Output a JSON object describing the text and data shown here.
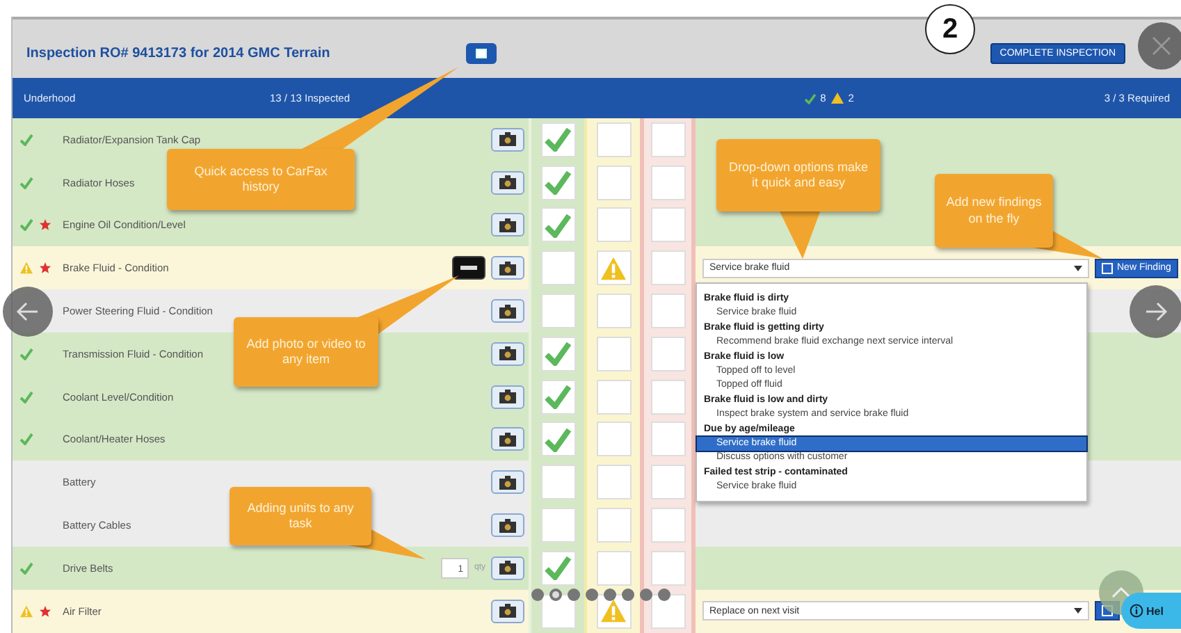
{
  "figure_number": "2",
  "header": {
    "title": "Inspection RO# 9413173 for 2014 GMC Terrain",
    "complete_button": "COMPLETE INSPECTION"
  },
  "section_bar": {
    "name": "Underhood",
    "progress": "13 / 13 Inspected",
    "ok_count": "8",
    "warning_count": "2",
    "required": "3 / 3 Required"
  },
  "rows": [
    {
      "name": "Radiator/Expansion Tank Cap",
      "ok": true,
      "warning": false,
      "failed": false,
      "required": false,
      "video": false
    },
    {
      "name": "Radiator Hoses",
      "ok": true,
      "warning": false,
      "failed": false,
      "required": false,
      "video": false
    },
    {
      "name": "Engine Oil Condition/Level",
      "ok": true,
      "warning": false,
      "failed": false,
      "required": true,
      "video": false
    },
    {
      "name": "Brake Fluid - Condition",
      "ok": false,
      "warning": true,
      "failed": false,
      "required": true,
      "video": true,
      "finding": "Service brake fluid",
      "new_finding": {
        "kind": "full",
        "label": "New Finding"
      }
    },
    {
      "name": "Power Steering Fluid - Condition",
      "ok": false,
      "warning": false,
      "failed": false,
      "required": false,
      "video": false
    },
    {
      "name": "Transmission Fluid - Condition",
      "ok": true,
      "warning": false,
      "failed": false,
      "required": false,
      "video": false
    },
    {
      "name": "Coolant Level/Condition",
      "ok": true,
      "warning": false,
      "failed": false,
      "required": false,
      "video": false
    },
    {
      "name": "Coolant/Heater Hoses",
      "ok": true,
      "warning": false,
      "failed": false,
      "required": false,
      "video": false
    },
    {
      "name": "Battery",
      "ok": false,
      "warning": false,
      "failed": false,
      "required": false,
      "video": false
    },
    {
      "name": "Battery Cables",
      "ok": false,
      "warning": false,
      "failed": false,
      "required": false,
      "video": false
    },
    {
      "name": "Drive Belts",
      "ok": true,
      "warning": false,
      "failed": false,
      "required": false,
      "video": false,
      "units": {
        "value": "1",
        "unit": "qty"
      }
    },
    {
      "name": "Air Filter",
      "ok": false,
      "warning": true,
      "failed": false,
      "required": true,
      "video": false,
      "finding": "Replace on next visit",
      "new_finding": {
        "kind": "icon"
      }
    }
  ],
  "dropdown_options": [
    {
      "label": "Brake fluid is dirty",
      "kind": "group",
      "selected": false
    },
    {
      "label": "Service brake fluid",
      "kind": "option",
      "selected": false
    },
    {
      "label": "Brake fluid is getting dirty",
      "kind": "group",
      "selected": false
    },
    {
      "label": "Recommend brake fluid exchange next service interval",
      "kind": "option",
      "selected": false
    },
    {
      "label": "Brake fluid is low",
      "kind": "group",
      "selected": false
    },
    {
      "label": "Topped off to level",
      "kind": "option",
      "selected": false
    },
    {
      "label": "Topped off fluid",
      "kind": "option",
      "selected": false
    },
    {
      "label": "Brake fluid is low and dirty",
      "kind": "group",
      "selected": false
    },
    {
      "label": "Inspect brake system and service brake fluid",
      "kind": "option",
      "selected": false
    },
    {
      "label": "Due by age/mileage",
      "kind": "group",
      "selected": false
    },
    {
      "label": "Service brake fluid",
      "kind": "option",
      "selected": true
    },
    {
      "label": "Discuss options with customer",
      "kind": "option",
      "selected": false
    },
    {
      "label": "Failed test strip - contaminated",
      "kind": "group",
      "selected": false
    },
    {
      "label": "Service brake fluid",
      "kind": "option",
      "selected": false
    }
  ],
  "callouts": [
    {
      "text": "Quick access to CarFax history"
    },
    {
      "text": "Drop-down options make it quick and easy"
    },
    {
      "text": "Add new findings on the fly"
    },
    {
      "text": "Add photo or video to any item"
    },
    {
      "text": "Adding units to any task"
    }
  ],
  "carousel_dots": [
    {
      "selected": false
    },
    {
      "selected": true
    },
    {
      "selected": false
    },
    {
      "selected": false
    },
    {
      "selected": false
    },
    {
      "selected": false
    },
    {
      "selected": false
    },
    {
      "selected": false
    }
  ],
  "help_button": "Hel"
}
